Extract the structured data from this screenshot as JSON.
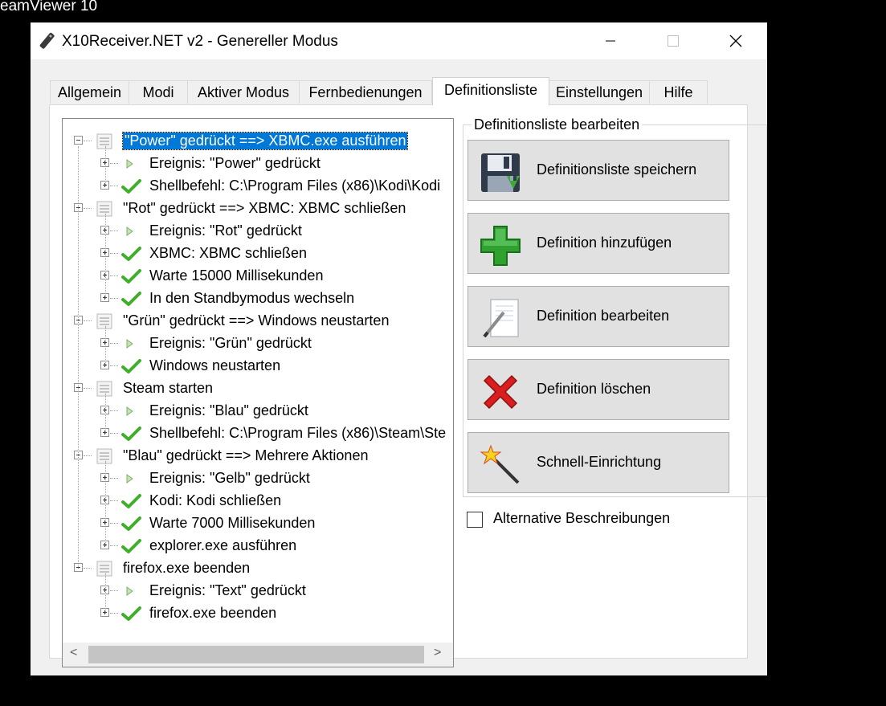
{
  "background": {
    "window_title_fragment": "eamViewer 10"
  },
  "window": {
    "title": "X10Receiver.NET v2 - Genereller Modus",
    "minimize_glyph": "—",
    "maximize_glyph": "☐",
    "close_glyph": "✕"
  },
  "tabs": [
    {
      "label": "Allgemein",
      "active": false
    },
    {
      "label": "Modi",
      "active": false
    },
    {
      "label": "Aktiver Modus",
      "active": false
    },
    {
      "label": "Fernbedienungen",
      "active": false
    },
    {
      "label": "Definitionsliste",
      "active": true
    },
    {
      "label": "Einstellungen",
      "active": false
    },
    {
      "label": "Hilfe",
      "active": false
    }
  ],
  "tree": {
    "scroll_left": "<",
    "scroll_right": ">",
    "items": [
      {
        "level": 0,
        "label": "\"Power\" gedrückt ==> XBMC.exe ausführen",
        "selected": true
      },
      {
        "level": 1,
        "icon": "play-icon",
        "label": "Ereignis: \"Power\" gedrückt"
      },
      {
        "level": 1,
        "icon": "check-icon",
        "label": "Shellbefehl: C:\\Program Files (x86)\\Kodi\\Kodi"
      },
      {
        "level": 0,
        "label": "\"Rot\" gedrückt ==> XBMC: XBMC schließen"
      },
      {
        "level": 1,
        "icon": "play-icon",
        "label": "Ereignis: \"Rot\" gedrückt"
      },
      {
        "level": 1,
        "icon": "check-icon",
        "label": "XBMC: XBMC schließen"
      },
      {
        "level": 1,
        "icon": "check-icon",
        "label": "Warte 15000 Millisekunden"
      },
      {
        "level": 1,
        "icon": "check-icon",
        "label": "In den Standbymodus wechseln"
      },
      {
        "level": 0,
        "label": "\"Grün\" gedrückt ==> Windows neustarten"
      },
      {
        "level": 1,
        "icon": "play-icon",
        "label": "Ereignis: \"Grün\" gedrückt"
      },
      {
        "level": 1,
        "icon": "check-icon",
        "label": "Windows neustarten"
      },
      {
        "level": 0,
        "label": "Steam starten"
      },
      {
        "level": 1,
        "icon": "play-icon",
        "label": "Ereignis: \"Blau\" gedrückt"
      },
      {
        "level": 1,
        "icon": "check-icon",
        "label": "Shellbefehl: C:\\Program Files (x86)\\Steam\\Ste"
      },
      {
        "level": 0,
        "label": "\"Blau\" gedrückt ==> Mehrere Aktionen"
      },
      {
        "level": 1,
        "icon": "play-icon",
        "label": "Ereignis: \"Gelb\" gedrückt"
      },
      {
        "level": 1,
        "icon": "check-icon",
        "label": "Kodi: Kodi schließen"
      },
      {
        "level": 1,
        "icon": "check-icon",
        "label": "Warte 7000 Millisekunden"
      },
      {
        "level": 1,
        "icon": "check-icon",
        "label": "explorer.exe ausführen"
      },
      {
        "level": 0,
        "label": "firefox.exe beenden"
      },
      {
        "level": 1,
        "icon": "play-icon",
        "label": "Ereignis: \"Text\" gedrückt"
      },
      {
        "level": 1,
        "icon": "check-icon",
        "label": "firefox.exe beenden"
      }
    ]
  },
  "edit_group": {
    "label": "Definitionsliste bearbeiten",
    "buttons": [
      {
        "name": "save-definitions-button",
        "icon": "floppy-disk-icon",
        "label": "Definitionsliste speichern"
      },
      {
        "name": "add-definition-button",
        "icon": "plus-icon",
        "label": "Definition hinzufügen"
      },
      {
        "name": "edit-definition-button",
        "icon": "pen-paper-icon",
        "label": "Definition bearbeiten"
      },
      {
        "name": "delete-definition-button",
        "icon": "red-x-icon",
        "label": "Definition löschen"
      },
      {
        "name": "quick-setup-button",
        "icon": "magic-wand-icon",
        "label": "Schnell-Einrichtung"
      }
    ]
  },
  "alt_descriptions": {
    "label": "Alternative Beschreibungen",
    "checked": false
  },
  "colors": {
    "selection": "#0078d7",
    "check_green": "#3fae2a",
    "plus_green": "#2ea12e",
    "delete_red": "#d81e1e"
  }
}
